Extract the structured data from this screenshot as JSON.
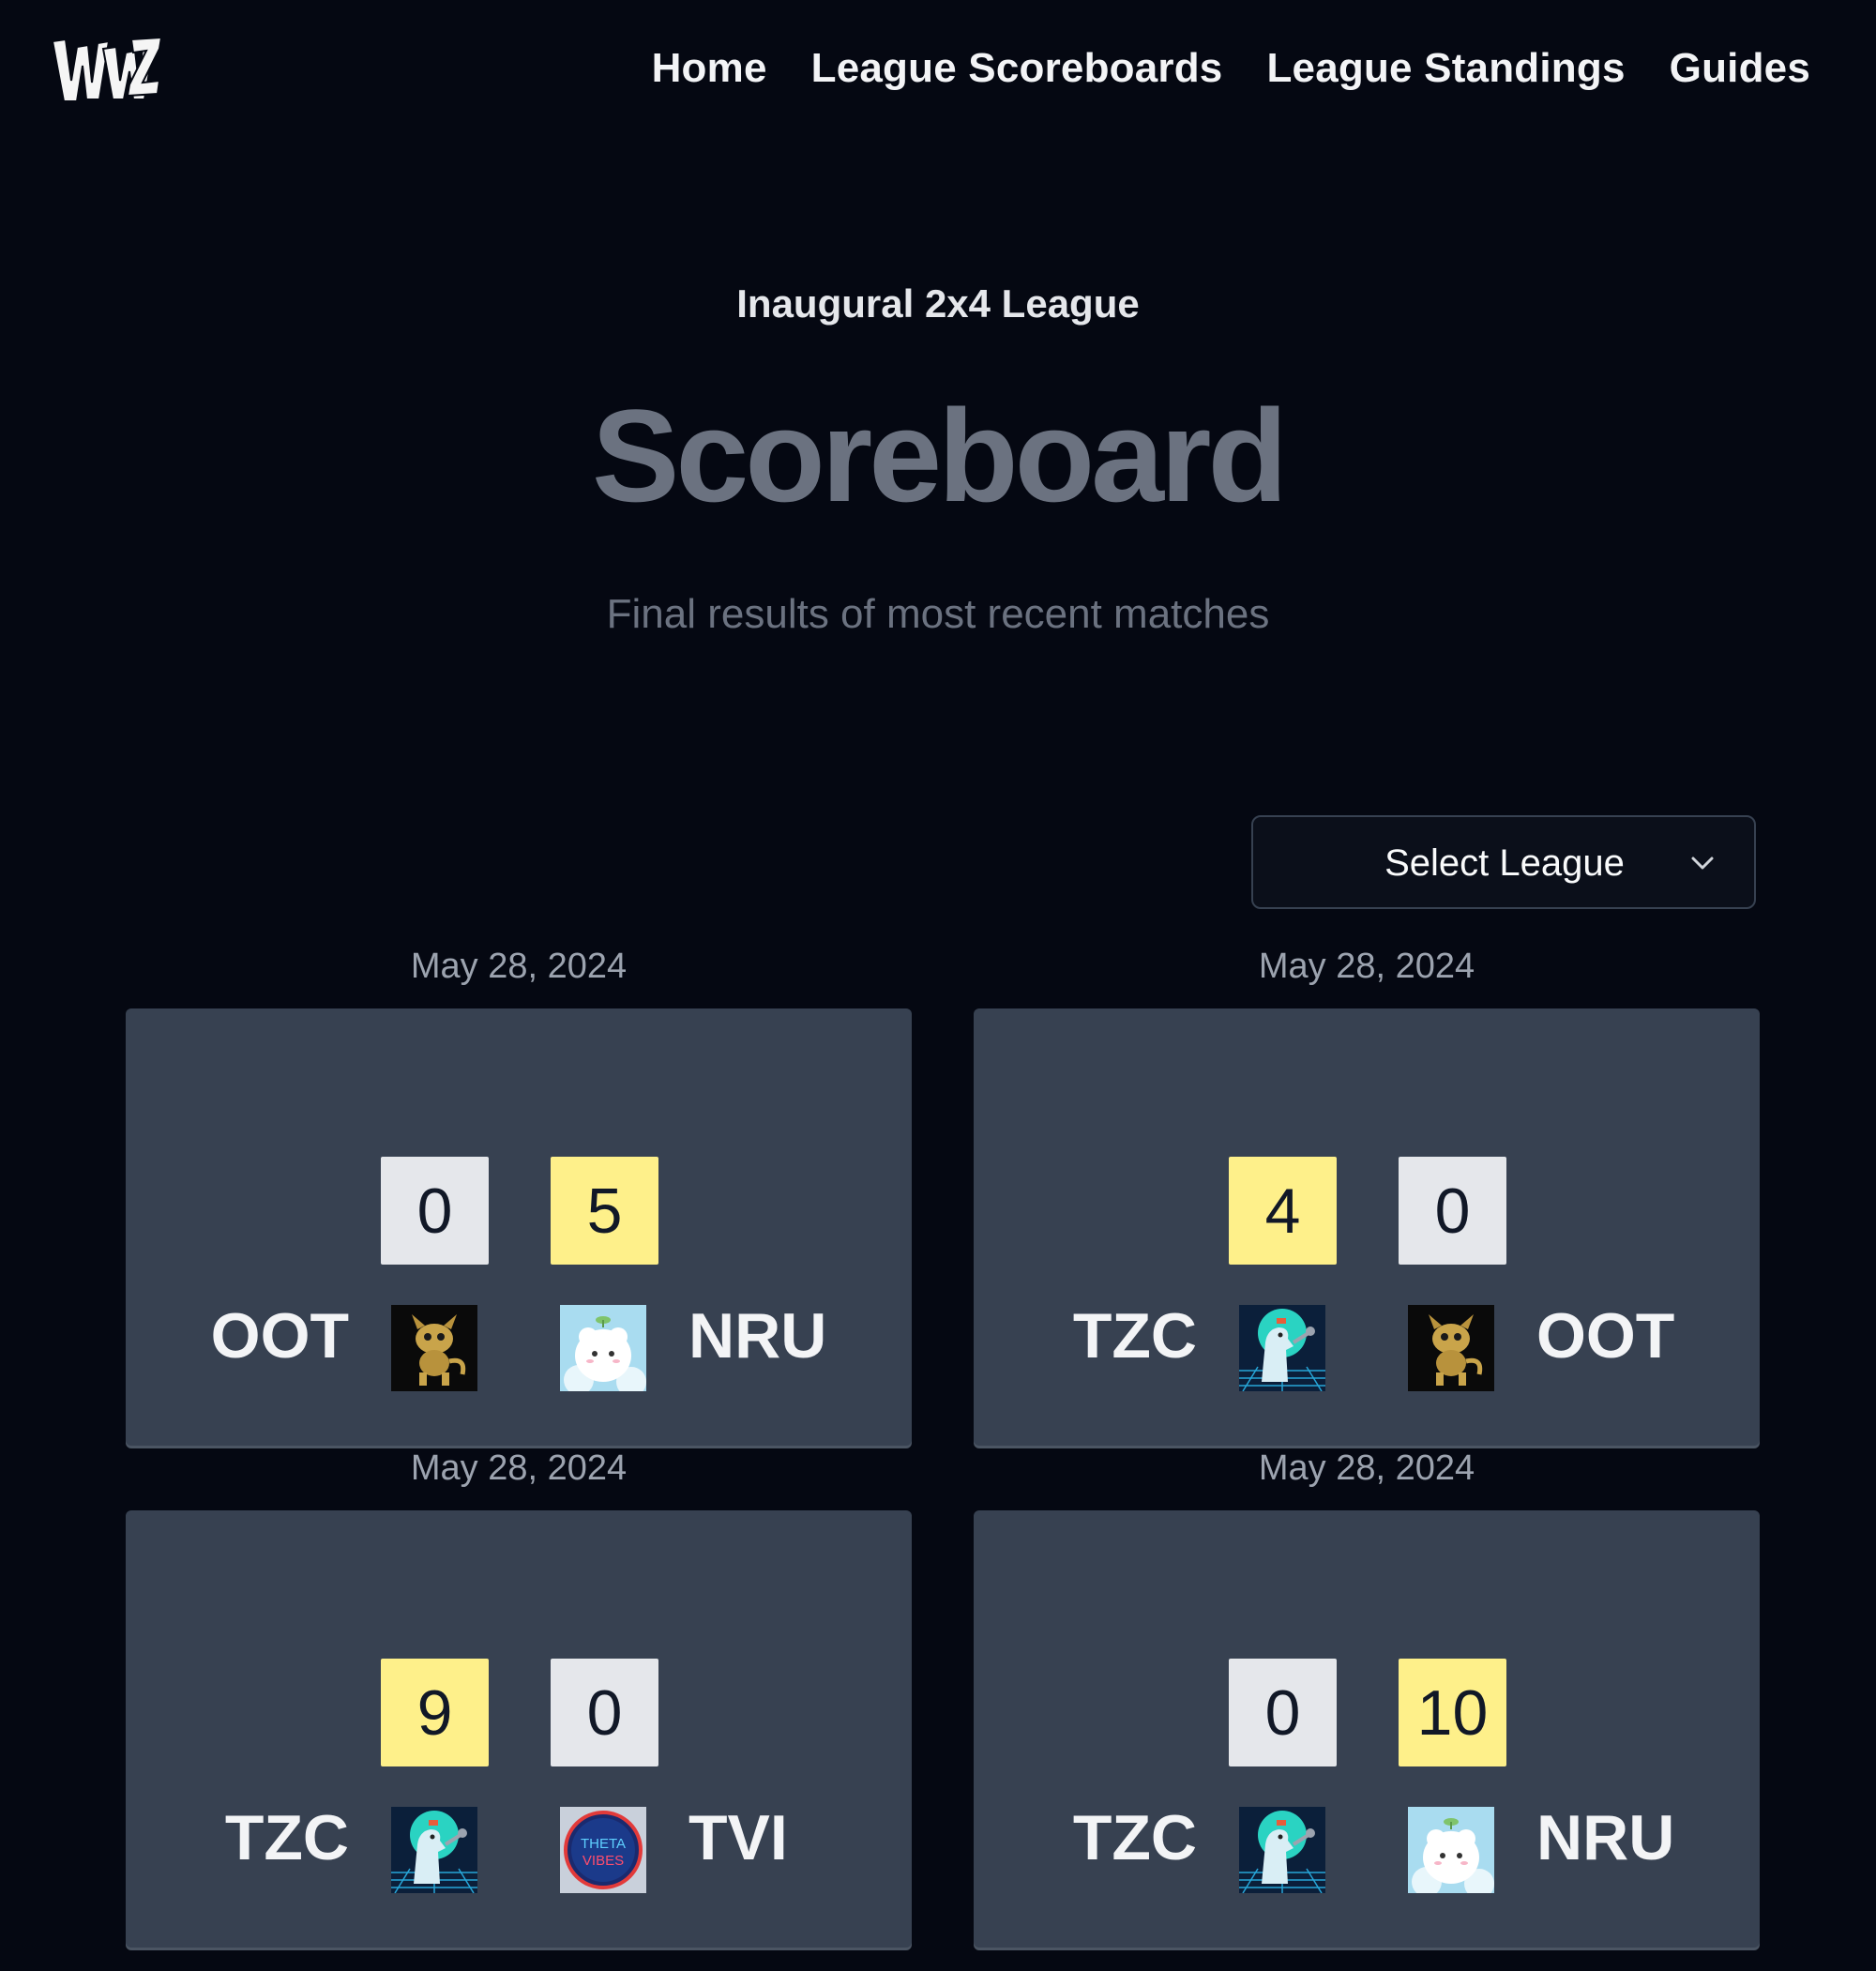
{
  "nav": {
    "logo_text": "WWZ",
    "links": [
      "Home",
      "League Scoreboards",
      "League Standings",
      "Guides"
    ]
  },
  "header": {
    "league_name": "Inaugural 2x4 League",
    "title": "Scoreboard",
    "subtitle": "Final results of most recent matches"
  },
  "league_select": {
    "label": "Select League",
    "icon": "chevron-down-icon"
  },
  "colors": {
    "background": "#050812",
    "card": "#374151",
    "win_score_bg": "#fef08a",
    "lose_score_bg": "#e5e7eb"
  },
  "matches": [
    {
      "date": "May 28, 2024",
      "home": {
        "team": "OOT",
        "score": "0",
        "result": "lose",
        "avatar": "golden-creature-avatar"
      },
      "away": {
        "team": "NRU",
        "score": "5",
        "result": "win",
        "avatar": "white-alpaca-avatar"
      }
    },
    {
      "date": "May 28, 2024",
      "home": {
        "team": "TZC",
        "score": "4",
        "result": "win",
        "avatar": "dinosaur-avatar"
      },
      "away": {
        "team": "OOT",
        "score": "0",
        "result": "lose",
        "avatar": "golden-creature-avatar"
      }
    },
    {
      "date": "May 28, 2024",
      "home": {
        "team": "TZC",
        "score": "9",
        "result": "win",
        "avatar": "dinosaur-avatar"
      },
      "away": {
        "team": "TVI",
        "score": "0",
        "result": "lose",
        "avatar": "theta-vibes-avatar"
      }
    },
    {
      "date": "May 28, 2024",
      "home": {
        "team": "TZC",
        "score": "0",
        "result": "lose",
        "avatar": "dinosaur-avatar"
      },
      "away": {
        "team": "NRU",
        "score": "10",
        "result": "win",
        "avatar": "white-alpaca-avatar"
      }
    }
  ],
  "avatar_text": {
    "theta_line1": "THETA",
    "theta_line2": "VIBES"
  }
}
